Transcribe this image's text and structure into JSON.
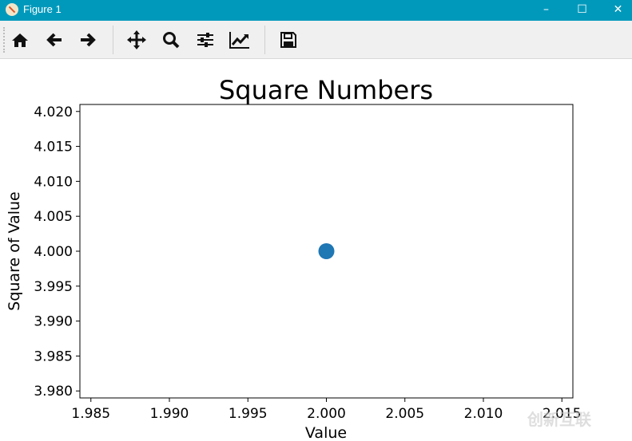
{
  "window": {
    "title": "Figure 1",
    "minimize_icon": "minimize-icon",
    "maximize_icon": "maximize-icon",
    "close_icon": "close-icon"
  },
  "toolbar": {
    "buttons": [
      "home-icon",
      "back-icon",
      "forward-icon",
      "pan-icon",
      "zoom-icon",
      "configure-subplots-icon",
      "edit-axis-icon",
      "save-icon"
    ]
  },
  "watermark": "创新互联",
  "chart_data": {
    "type": "scatter",
    "title": "Square Numbers",
    "xlabel": "Value",
    "ylabel": "Square of Value",
    "x": [
      2
    ],
    "y": [
      4
    ],
    "xlim": [
      1.9843,
      2.0157
    ],
    "ylim": [
      3.979,
      4.021
    ],
    "xticks": [
      "1.985",
      "1.990",
      "1.995",
      "2.000",
      "2.005",
      "2.010",
      "2.015"
    ],
    "yticks": [
      "3.980",
      "3.985",
      "3.990",
      "3.995",
      "4.000",
      "4.005",
      "4.010",
      "4.015",
      "4.020"
    ],
    "grid": false,
    "color": "#1f77b4"
  }
}
